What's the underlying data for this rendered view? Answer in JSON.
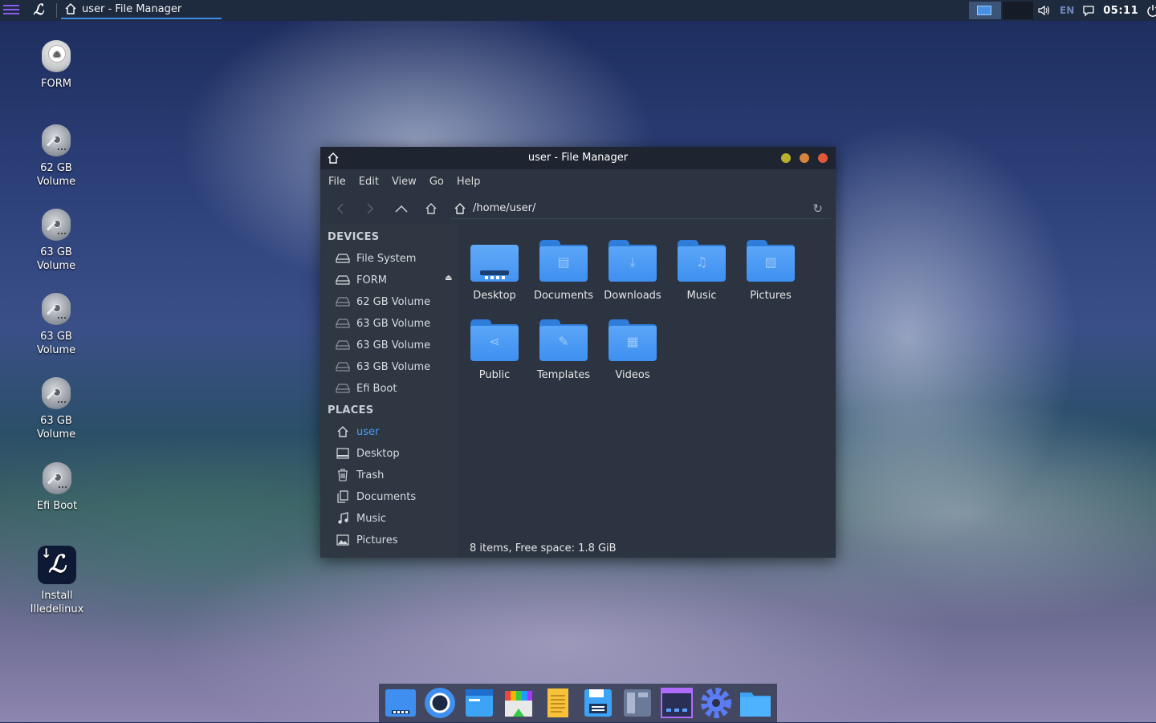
{
  "top_panel": {
    "task_title": "user - File Manager",
    "language": "EN",
    "clock": "05:11"
  },
  "desktop_icons": [
    {
      "label": "FORM"
    },
    {
      "label": "62 GB Volume"
    },
    {
      "label": "63 GB Volume"
    },
    {
      "label": "63 GB Volume"
    },
    {
      "label": "63 GB Volume"
    },
    {
      "label": "Efi Boot"
    },
    {
      "label": "Install Illedelinux"
    }
  ],
  "window": {
    "title": "user - File Manager",
    "menu": [
      "File",
      "Edit",
      "View",
      "Go",
      "Help"
    ],
    "path": "/home/user/",
    "sidebar": {
      "devices_heading": "DEVICES",
      "devices": [
        "File System",
        "FORM",
        "62 GB Volume",
        "63 GB Volume",
        "63 GB Volume",
        "63 GB Volume",
        "Efi Boot"
      ],
      "places_heading": "PLACES",
      "places": [
        "user",
        "Desktop",
        "Trash",
        "Documents",
        "Music",
        "Pictures"
      ]
    },
    "files": [
      {
        "name": "Desktop",
        "icon": "desktop-folder-icon"
      },
      {
        "name": "Documents",
        "icon": "documents-folder-icon"
      },
      {
        "name": "Downloads",
        "icon": "downloads-folder-icon"
      },
      {
        "name": "Music",
        "icon": "music-folder-icon"
      },
      {
        "name": "Pictures",
        "icon": "pictures-folder-icon"
      },
      {
        "name": "Public",
        "icon": "public-folder-icon"
      },
      {
        "name": "Templates",
        "icon": "templates-folder-icon"
      },
      {
        "name": "Videos",
        "icon": "videos-folder-icon"
      }
    ],
    "status": "8 items, Free space: 1.8 GiB"
  },
  "colors": {
    "accent": "#4a9dff",
    "folder": "#4a97f4",
    "close": "#e0573c",
    "maximize": "#d4843c",
    "minimize": "#b8b02c"
  },
  "dock": [
    "show-desktop-icon",
    "browser-icon",
    "file-manager-icon",
    "app-store-icon",
    "text-editor-icon",
    "save-disk-icon",
    "terminal-window-icon",
    "window-switcher-icon",
    "settings-gear-icon",
    "home-folder-icon"
  ]
}
